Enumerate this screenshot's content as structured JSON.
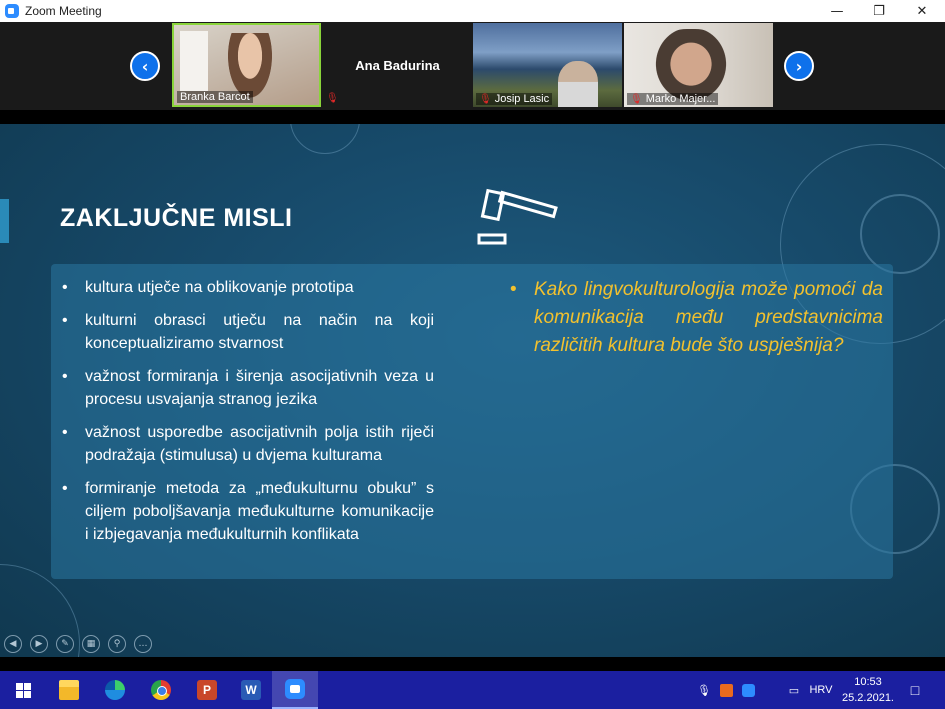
{
  "window": {
    "title": "Zoom Meeting"
  },
  "participants": [
    {
      "name": "Branka Barcot",
      "muted": false,
      "speaking": true
    },
    {
      "name": "Ana Badurina",
      "muted": true,
      "video": false
    },
    {
      "name": "Josip Lasic",
      "muted": true
    },
    {
      "name": "Marko Majer...",
      "muted": true
    }
  ],
  "slide": {
    "heading": "ZAKLJUČNE MISLI",
    "left_bullets": [
      "kultura utječe na oblikovanje prototipa",
      "kulturni obrasci utječu na način na koji konceptualiziramo stvarnost",
      "važnost formiranja i širenja asocijativnih veza u procesu usvajanja stranog jezika",
      "važnost usporedbe asocijativnih polja istih riječi podražaja (stimulusa) u dvjema kulturama",
      "formiranje metoda za „međukulturnu obuku” s ciljem poboljšavanja međukulturne komunikacije i izbjegavanja međukulturnih konflikata"
    ],
    "right_bullets": [
      "Kako lingvokulturologija može pomoći da komunikacija među predstavnicima različitih kultura bude što uspješnija?"
    ],
    "tools": [
      "previous",
      "next",
      "pen",
      "slides",
      "zoom",
      "more"
    ],
    "highlight_color": "#f2c12e"
  },
  "taskbar": {
    "apps": [
      "start",
      "file-explorer",
      "edge",
      "chrome",
      "powerpoint",
      "word",
      "zoom"
    ],
    "active_app": "zoom",
    "language": "HRV",
    "time": "10:53",
    "date": "25.2.2021."
  }
}
